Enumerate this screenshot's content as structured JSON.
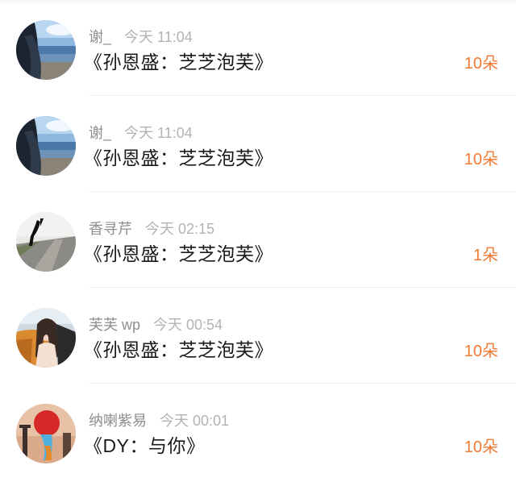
{
  "gifts": [
    {
      "name": "谢_",
      "time": "今天 11:04",
      "title": "《孙恩盛：芝芝泡芙》",
      "amount": "10朵",
      "avatar": "avatar-sea-girl"
    },
    {
      "name": "谢_",
      "time": "今天 11:04",
      "title": "《孙恩盛：芝芝泡芙》",
      "amount": "10朵",
      "avatar": "avatar-sea-girl"
    },
    {
      "name": "香寻芹",
      "time": "今天 02:15",
      "title": "《孙恩盛：芝芝泡芙》",
      "amount": "1朵",
      "avatar": "avatar-road-runner"
    },
    {
      "name": "芙芙 wp",
      "time": "今天 00:54",
      "title": "《孙恩盛：芝芝泡芙》",
      "amount": "10朵",
      "avatar": "avatar-girl-car"
    },
    {
      "name": "纳喇紫易",
      "time": "今天 00:01",
      "title": "《DY：与你》",
      "amount": "10朵",
      "avatar": "avatar-balloon-city"
    }
  ],
  "colors": {
    "amount": "#f07a34",
    "title": "#1a1a1a",
    "meta": "#9a9a9a"
  }
}
